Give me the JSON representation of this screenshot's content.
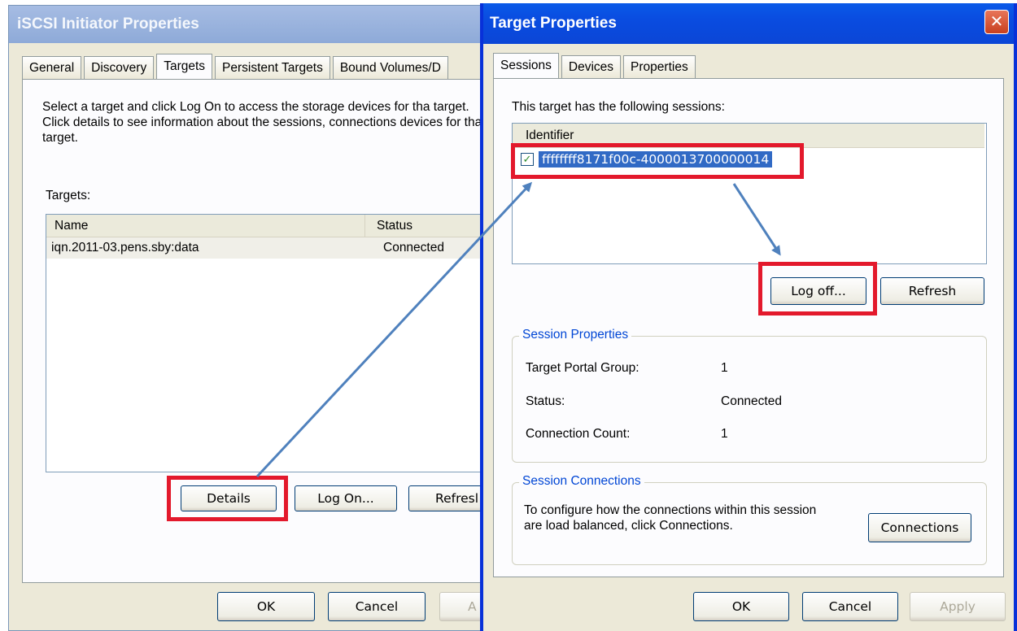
{
  "left_window": {
    "title": "iSCSI Initiator Properties",
    "tabs": [
      {
        "label": "General"
      },
      {
        "label": "Discovery"
      },
      {
        "label": "Targets"
      },
      {
        "label": "Persistent Targets"
      },
      {
        "label": "Bound Volumes/D"
      }
    ],
    "instructions": "Select a target and click Log On to access the storage devices for tha target. Click details to see information about the sessions, connections devices for that target.",
    "targets_label": "Targets:",
    "columns": {
      "name": "Name",
      "status": "Status"
    },
    "rows": [
      {
        "name": "iqn.2011-03.pens.sby:data",
        "status": "Connected"
      }
    ],
    "buttons": {
      "details": "Details",
      "log_on": "Log On...",
      "refresh": "Refresl",
      "ok": "OK",
      "cancel": "Cancel",
      "apply": "A"
    }
  },
  "right_window": {
    "title": "Target Properties",
    "close_glyph": "✕",
    "tabs": [
      {
        "label": "Sessions"
      },
      {
        "label": "Devices"
      },
      {
        "label": "Properties"
      }
    ],
    "sessions_label": "This target has the following sessions:",
    "identifier_header": "Identifier",
    "session_id": "ffffffff8171f00c-4000013700000014",
    "session_checked": true,
    "buttons": {
      "log_off": "Log off...",
      "refresh": "Refresh",
      "connections": "Connections",
      "ok": "OK",
      "cancel": "Cancel",
      "apply": "Apply"
    },
    "session_properties": {
      "title": "Session Properties",
      "rows": [
        {
          "label": "Target Portal Group:",
          "value": "1"
        },
        {
          "label": "Status:",
          "value": "Connected"
        },
        {
          "label": "Connection Count:",
          "value": "1"
        }
      ]
    },
    "session_connections": {
      "title": "Session Connections",
      "text": "To configure how the connections within this session are load balanced, click Connections."
    }
  },
  "colors": {
    "highlight_box": "#e3192c",
    "annotation_arrow": "#4f81bd",
    "title_bar_active": "#0a4ce0",
    "selection": "#316ac5"
  },
  "icons": {
    "close": "close-icon",
    "checkbox": "checkbox-icon",
    "arrows": "annotation-arrow-icon"
  }
}
